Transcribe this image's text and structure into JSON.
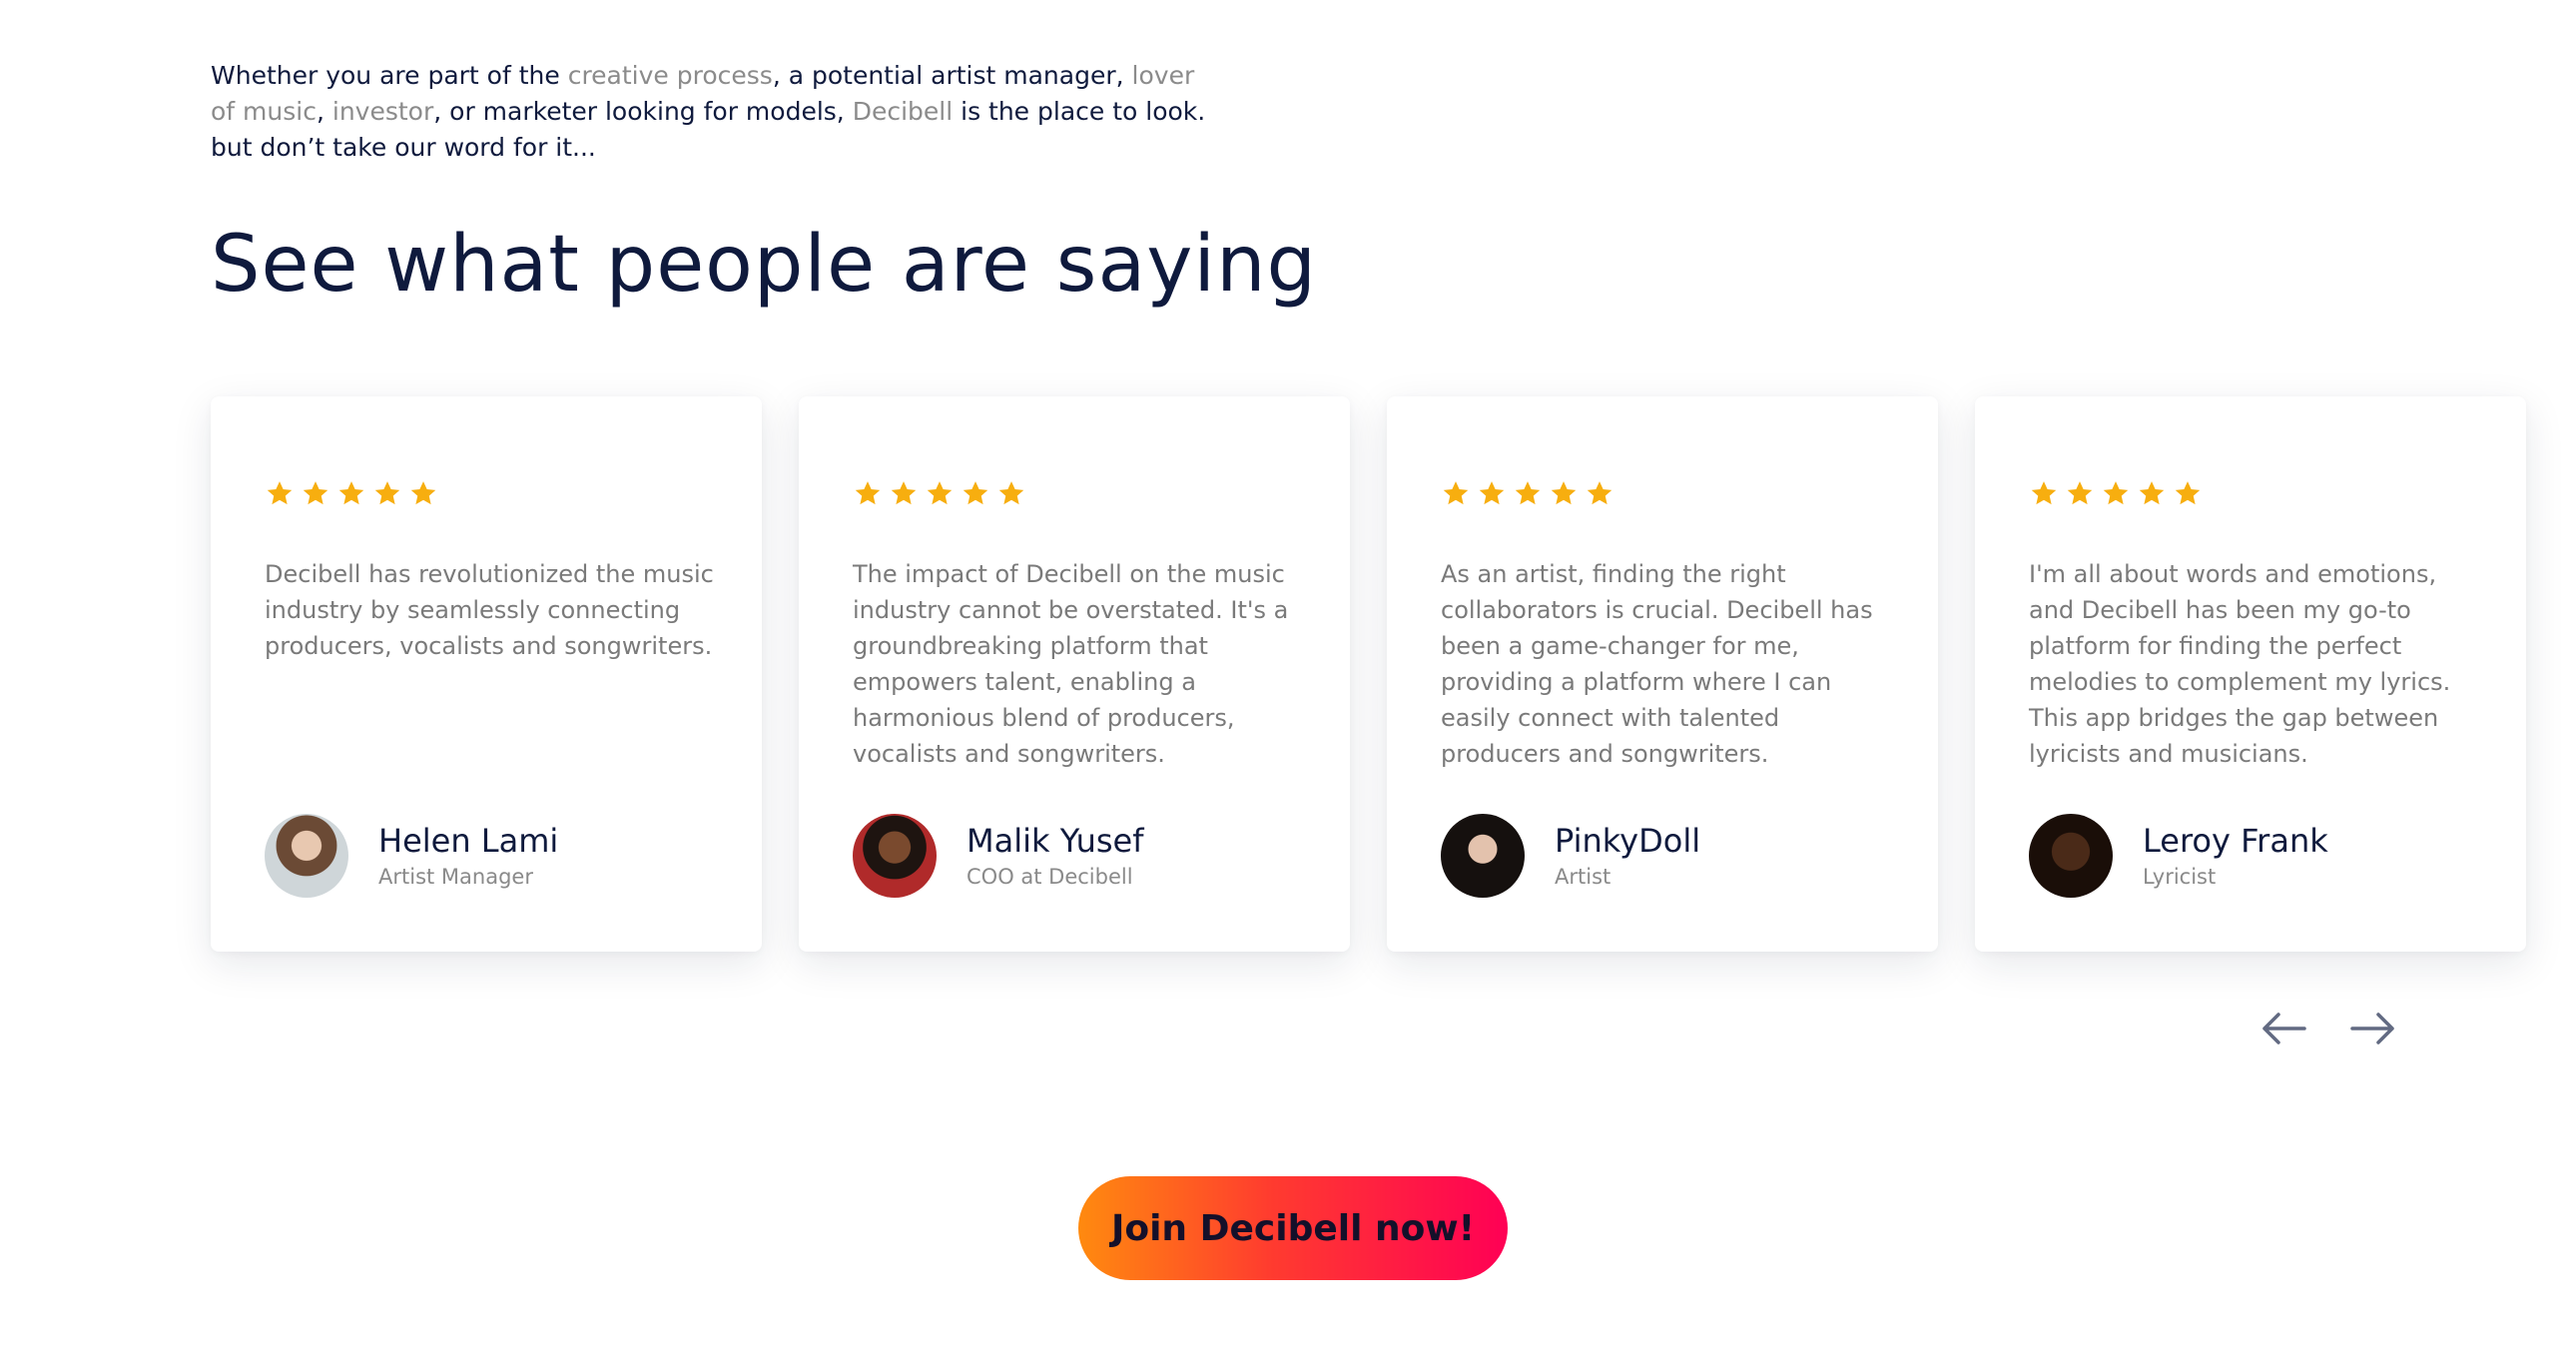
{
  "intro": {
    "t1": "Whether you are part of the ",
    "link_creative": "creative process",
    "t2": ", a potential artist manager, ",
    "link_lover": "lover of music",
    "t3": ", ",
    "link_investor": "investor",
    "t4": ", or marketer looking for models,  ",
    "link_decibell": "Decibell",
    "t5": " is the place to look. but don’t take our word for it..."
  },
  "heading": "See what people are saying",
  "colors": {
    "navy": "#0f1a3d",
    "star": "#f7ae0f",
    "muted": "#8b8b8b",
    "cta_start": "#ff8a0f",
    "cta_end": "#ff0055"
  },
  "testimonials": [
    {
      "rating": 5,
      "quote": "Decibell has revolutionized the music industry by seamlessly connecting producers, vocalists and songwriters.",
      "name": "Helen Lami",
      "role": "Artist Manager",
      "avatar": "avatar-helen"
    },
    {
      "rating": 5,
      "quote": "The impact of Decibell on the music industry cannot be overstated. It's a groundbreaking platform that empowers talent, enabling a harmonious blend of producers, vocalists and songwriters.",
      "name": "Malik Yusef",
      "role": "COO at Decibell",
      "avatar": "avatar-malik"
    },
    {
      "rating": 5,
      "quote": "As an artist, finding the right collaborators is crucial. Decibell has been a game-changer for me, providing a platform where I can easily connect with talented producers and songwriters.",
      "name": "PinkyDoll",
      "role": "Artist",
      "avatar": "avatar-pinkydoll"
    },
    {
      "rating": 5,
      "quote": "I'm all about words and emotions, and Decibell has been my go-to platform for finding the perfect melodies to complement my lyrics. This app bridges the gap between lyricists and musicians.",
      "name": "Leroy Frank",
      "role": "Lyricist",
      "avatar": "avatar-leroy"
    }
  ],
  "nav": {
    "prev_icon": "arrow-left-icon",
    "next_icon": "arrow-right-icon"
  },
  "cta": {
    "label": "Join Decibell now!"
  }
}
